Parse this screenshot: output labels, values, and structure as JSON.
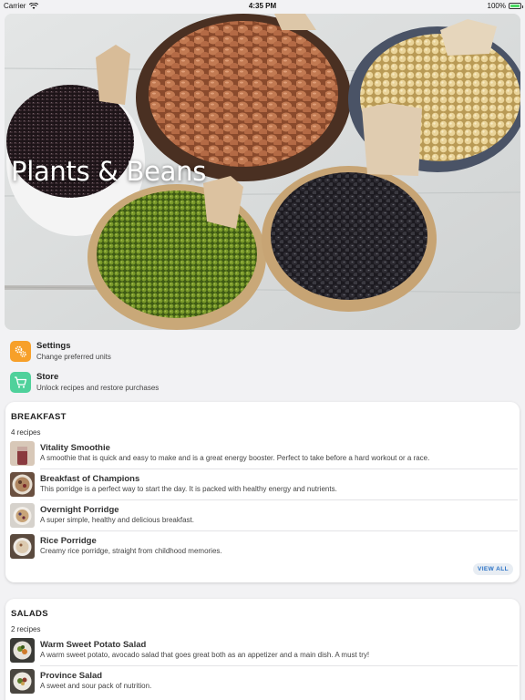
{
  "status_bar": {
    "carrier": "Carrier",
    "time": "4:35 PM",
    "battery": "100%",
    "battery_level": 1.0
  },
  "hero": {
    "title": "Plants & Beans"
  },
  "menu": [
    {
      "title": "Settings",
      "subtitle": "Change preferred units",
      "icon": "gear-icon",
      "color": "#f7a02a"
    },
    {
      "title": "Store",
      "subtitle": "Unlock recipes and restore purchases",
      "icon": "cart-icon",
      "color": "#4fd19b"
    }
  ],
  "sections": [
    {
      "title": "BREAKFAST",
      "count": "4 recipes",
      "view_all": "VIEW ALL",
      "recipes": [
        {
          "title": "Vitality Smoothie",
          "description": "A smoothie that is quick and easy to make and is a great energy booster. Perfect to take before a hard workout or a race."
        },
        {
          "title": "Breakfast of Champions",
          "description": "This porridge is a perfect way to start the day. It is packed with healthy energy and nutrients."
        },
        {
          "title": "Overnight Porridge",
          "description": "A super simple, healthy and delicious breakfast."
        },
        {
          "title": "Rice Porridge",
          "description": "Creamy rice porridge, straight from childhood memories."
        }
      ]
    },
    {
      "title": "SALADS",
      "count": "2 recipes",
      "recipes": [
        {
          "title": "Warm Sweet Potato Salad",
          "description": "A warm sweet potato, avocado salad that goes great both as an appetizer and a main dish. A must try!"
        },
        {
          "title": "Province Salad",
          "description": "A sweet and sour pack of nutrition."
        }
      ]
    }
  ]
}
